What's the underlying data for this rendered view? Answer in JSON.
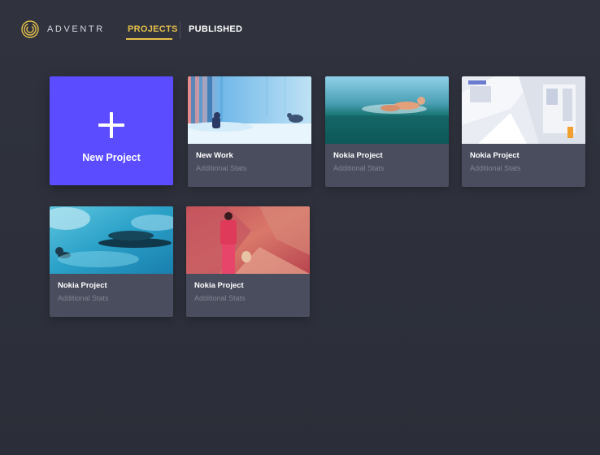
{
  "header": {
    "brand": "ADVENTR",
    "tabs": [
      {
        "label": "PROJECTS",
        "active": true
      },
      {
        "label": "PUBLISHED",
        "active": false
      }
    ],
    "accent_color": "#e6c04a"
  },
  "new_project": {
    "label": "New Project",
    "color": "#5b4cff",
    "icon": "plus-icon"
  },
  "projects": [
    {
      "title": "New Work",
      "stats": "Additional Stats",
      "thumbnail": "snowy-forest-illustration"
    },
    {
      "title": "Nokia Project",
      "stats": "Additional Stats",
      "thumbnail": "swimmer-ocean-photo"
    },
    {
      "title": "Nokia Project",
      "stats": "Additional Stats",
      "thumbnail": "white-architecture-photo"
    },
    {
      "title": "Nokia Project",
      "stats": "Additional Stats",
      "thumbnail": "underwater-diver-photo"
    },
    {
      "title": "Nokia Project",
      "stats": "Additional Stats",
      "thumbnail": "woman-red-landscape-photo"
    }
  ]
}
